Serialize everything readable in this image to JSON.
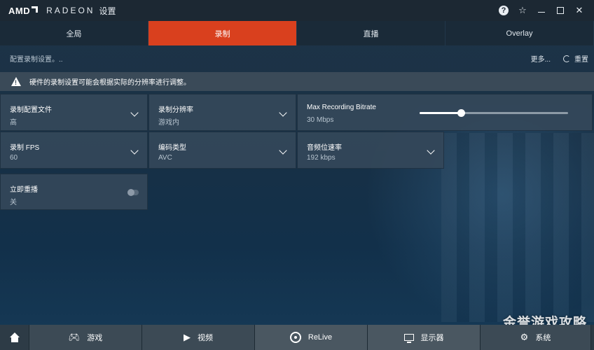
{
  "window": {
    "brand": "AMD",
    "product": "RADEON",
    "title": "设置",
    "icons": [
      "help-icon",
      "star-icon",
      "minimize-icon",
      "maximize-icon",
      "close-icon"
    ]
  },
  "tabs": [
    {
      "label": "全局",
      "active": false
    },
    {
      "label": "录制",
      "active": true
    },
    {
      "label": "直播",
      "active": false
    },
    {
      "label": "Overlay",
      "active": false
    }
  ],
  "subheader": {
    "title": "配置录制设置。..",
    "more_label": "更多...",
    "reset_label": "重置"
  },
  "warning": {
    "text": "硬件的录制设置可能会根据实际的分辨率进行调整。"
  },
  "settings": {
    "profile": {
      "label": "录制配置文件",
      "value": "高"
    },
    "resolution": {
      "label": "录制分辨率",
      "value": "游戏内"
    },
    "bitrate": {
      "label": "Max Recording Bitrate",
      "value": "30 Mbps",
      "slider_fraction": 0.28
    },
    "fps": {
      "label": "录制 FPS",
      "value": "60"
    },
    "encoder": {
      "label": "编码类型",
      "value": "AVC"
    },
    "audio_bitrate": {
      "label": "音频位速率",
      "value": "192 kbps"
    },
    "instant_replay": {
      "label": "立即重播",
      "value": "关",
      "enabled": false
    }
  },
  "bottomnav": {
    "items": [
      {
        "label": "游戏",
        "icon": "gamepad-icon"
      },
      {
        "label": "视频",
        "icon": "play-icon"
      },
      {
        "label": "ReLive",
        "icon": "relive-icon"
      },
      {
        "label": "显示器",
        "icon": "monitor-icon"
      },
      {
        "label": "系统",
        "icon": "system-icon"
      }
    ]
  },
  "watermark": "金誉游戏攻略",
  "colors": {
    "accent": "#d9401e",
    "tile": "#34485a",
    "warning_bar": "#3a4a58"
  }
}
